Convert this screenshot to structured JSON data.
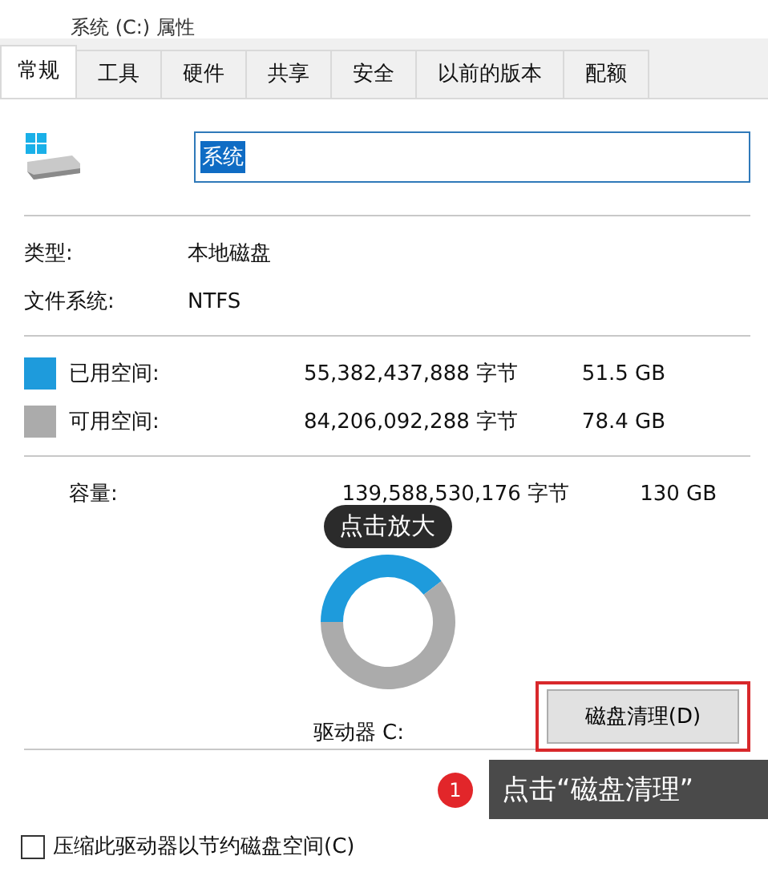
{
  "window": {
    "title": "系统 (C:) 属性"
  },
  "tabs": [
    {
      "label": "常规",
      "selected": true
    },
    {
      "label": "工具",
      "selected": false
    },
    {
      "label": "硬件",
      "selected": false
    },
    {
      "label": "共享",
      "selected": false
    },
    {
      "label": "安全",
      "selected": false
    },
    {
      "label": "以前的版本",
      "selected": false
    },
    {
      "label": "配额",
      "selected": false
    }
  ],
  "name_field": {
    "value": "系统"
  },
  "info": [
    {
      "label": "类型:",
      "value": "本地磁盘"
    },
    {
      "label": "文件系统:",
      "value": "NTFS"
    }
  ],
  "space": [
    {
      "label": "已用空间:",
      "bytes": "55,382,437,888 字节",
      "size": "51.5 GB",
      "color": "#1e9bdc"
    },
    {
      "label": "可用空间:",
      "bytes": "84,206,092,288 字节",
      "size": "78.4 GB",
      "color": "#ababab"
    }
  ],
  "capacity": {
    "label": "容量:",
    "bytes": "139,588,530,176 字节",
    "size": "130 GB"
  },
  "chart_data": {
    "type": "donut",
    "series": [
      {
        "values": [
          39.6,
          60.4
        ]
      }
    ]
  },
  "zoom_hint": "点击放大",
  "drive_label": "驱动器 C:",
  "cleanup_button": "磁盘清理(D)",
  "annotation": {
    "step": "1",
    "text": "点击“磁盘清理”"
  },
  "compress": {
    "label": "压缩此驱动器以节约磁盘空间(C)",
    "checked": false
  }
}
